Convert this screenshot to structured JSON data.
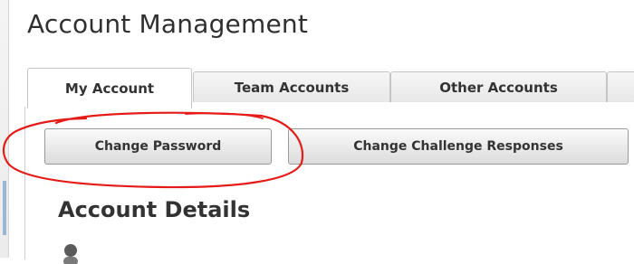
{
  "page": {
    "title": "Account Management"
  },
  "tabs": [
    {
      "label": "My Account",
      "active": true
    },
    {
      "label": "Team Accounts",
      "active": false
    },
    {
      "label": "Other Accounts",
      "active": false
    }
  ],
  "actions": {
    "change_password": "Change Password",
    "change_challenge": "Change Challenge Responses"
  },
  "section": {
    "title": "Account Details"
  },
  "colors": {
    "annotation": "#e41b17",
    "tab_border": "#c4c4c4"
  }
}
